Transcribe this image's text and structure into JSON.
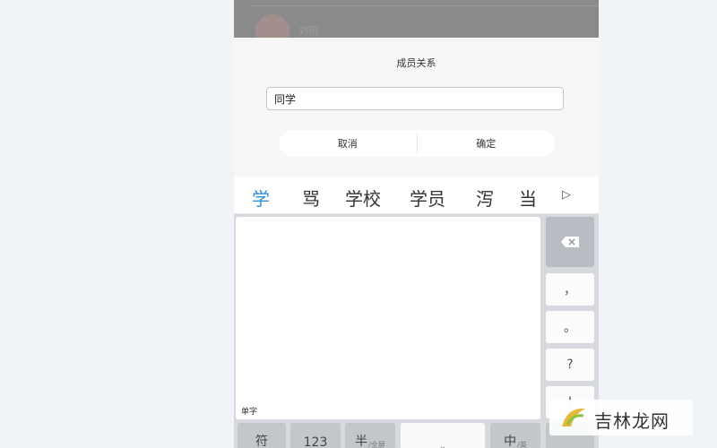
{
  "background_list": {
    "name": "刘阳"
  },
  "dialog": {
    "title": "成员关系",
    "input_value": "同学",
    "cancel_label": "取消",
    "confirm_label": "确定"
  },
  "candidates": [
    "学",
    "骂",
    "学校",
    "学员",
    "泻",
    "当"
  ],
  "keyboard": {
    "handwriting_mode_label": "单字",
    "side_keys": [
      "，",
      "。",
      "?",
      "!"
    ],
    "bottom_keys": {
      "symbols": "符",
      "numbers": "123",
      "half_width": "半",
      "half_width_sub": "/全屏",
      "space_symbol": "⎵",
      "chinese": "中",
      "chinese_sub": "/英"
    }
  },
  "watermark": {
    "text": "吉林龙网"
  },
  "colors": {
    "accent": "#2f8fd8"
  }
}
